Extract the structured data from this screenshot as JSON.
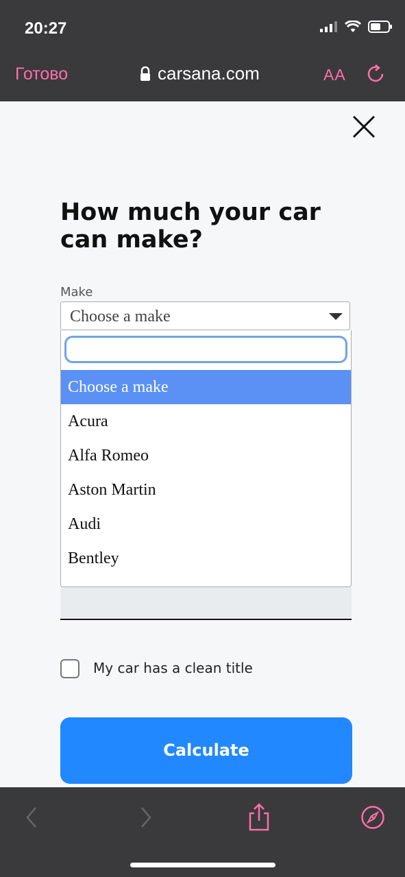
{
  "status_bar": {
    "time": "20:27"
  },
  "browser": {
    "done_label": "Готово",
    "url": "carsana.com",
    "text_size_label": "AA"
  },
  "page": {
    "headline": "How much your car can make?",
    "make_label": "Make",
    "make_select_value": "Choose a make",
    "dropdown_options": [
      "Choose a make",
      "Acura",
      "Alfa Romeo",
      "Aston Martin",
      "Audi",
      "Bentley"
    ],
    "dropdown_selected_index": 0,
    "clean_title_label": "My car has a clean title",
    "clean_title_checked": false,
    "calculate_label": "Calculate"
  },
  "colors": {
    "accent_pink": "#ff6fa8",
    "button_blue": "#2188ff",
    "selected_option_blue": "#5b91f5"
  }
}
